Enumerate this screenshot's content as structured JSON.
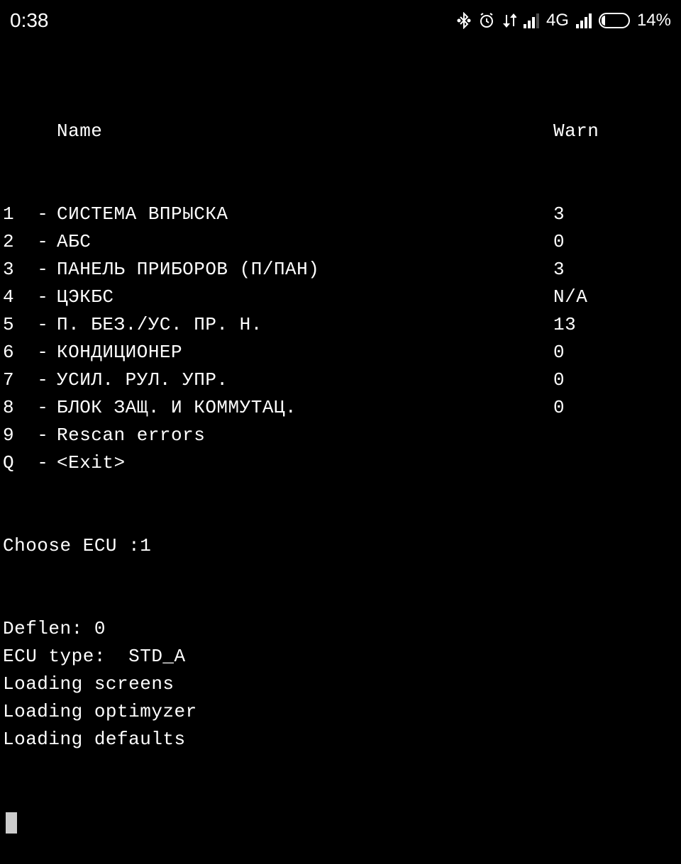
{
  "status_bar": {
    "time": "0:38",
    "network_type": "4G",
    "battery_percent": "14%",
    "battery_fill_width": "14%"
  },
  "terminal": {
    "header": {
      "name_label": "Name",
      "warn_label": "Warn"
    },
    "items": [
      {
        "key": "1",
        "sep": "-",
        "name": "СИСТЕМА ВПРЫСКА",
        "warn": "3"
      },
      {
        "key": "2",
        "sep": "-",
        "name": "АБС",
        "warn": "0"
      },
      {
        "key": "3",
        "sep": "-",
        "name": "ПАНЕЛЬ ПРИБОРОВ (П/ПАН)",
        "warn": "3"
      },
      {
        "key": "4",
        "sep": "-",
        "name": "ЦЭКБС",
        "warn": "N/A"
      },
      {
        "key": "5",
        "sep": "-",
        "name": "П. БЕЗ./УС. ПР. Н.",
        "warn": "13"
      },
      {
        "key": "6",
        "sep": "-",
        "name": "КОНДИЦИОНЕР",
        "warn": "0"
      },
      {
        "key": "7",
        "sep": "-",
        "name": "УСИЛ. РУЛ. УПР.",
        "warn": "0"
      },
      {
        "key": "8",
        "sep": "-",
        "name": "БЛОК ЗАЩ. И КОММУТАЦ.",
        "warn": "0"
      },
      {
        "key": "9",
        "sep": "-",
        "name": "Rescan errors",
        "warn": ""
      },
      {
        "key": "Q",
        "sep": "-",
        "name": "<Exit>",
        "warn": ""
      }
    ],
    "prompt": "Choose ECU :",
    "prompt_input": "1",
    "status_lines": [
      "Deflen: 0",
      "ECU type:  STD_A",
      "Loading screens",
      "Loading optimyzer",
      "Loading defaults"
    ]
  }
}
